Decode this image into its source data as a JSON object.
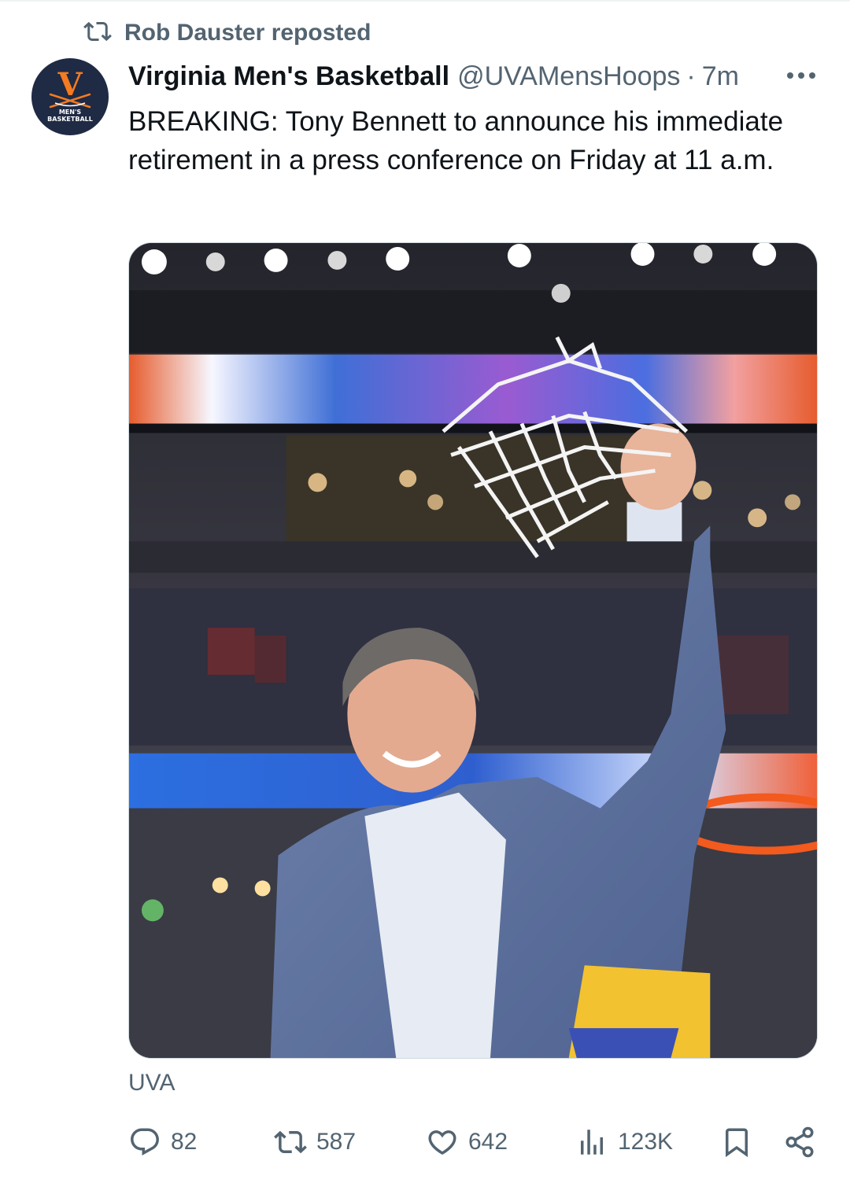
{
  "repost": {
    "text": "Rob Dauster reposted",
    "icon": "repost-icon"
  },
  "author": {
    "display_name": "Virginia Men's Basketball",
    "handle": "@UVAMensHoops",
    "separator": "·",
    "time": "7m",
    "avatar": {
      "letter": "V",
      "line1": "MEN'S",
      "line2": "BASKETBALL"
    }
  },
  "tweet": {
    "text": "BREAKING: Tony Bennett to announce his immediate retirement in a press conference on Friday at 11 a.m."
  },
  "media": {
    "caption": "UVA"
  },
  "actions": {
    "replies": "82",
    "reposts": "587",
    "likes": "642",
    "views": "123K"
  },
  "colors": {
    "text": "#0f1419",
    "secondary": "#536471",
    "border": "#cfd9de",
    "avatar_bg": "#1f2a44",
    "brand_orange": "#f47b20"
  }
}
